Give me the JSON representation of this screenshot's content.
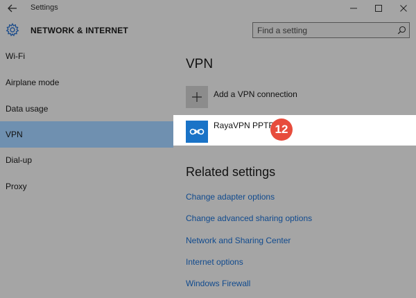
{
  "window": {
    "title": "Settings"
  },
  "header": {
    "section_title": "NETWORK & INTERNET",
    "search_placeholder": "Find a setting"
  },
  "sidebar": {
    "items": [
      {
        "label": "Wi-Fi",
        "active": false
      },
      {
        "label": "Airplane mode",
        "active": false
      },
      {
        "label": "Data usage",
        "active": false
      },
      {
        "label": "VPN",
        "active": true
      },
      {
        "label": "Dial-up",
        "active": false
      },
      {
        "label": "Proxy",
        "active": false
      }
    ]
  },
  "main": {
    "title": "VPN",
    "add_label": "Add a VPN connection",
    "connection": {
      "name": "RayaVPN PPTP",
      "badge": "12"
    },
    "related_title": "Related settings",
    "links": [
      "Change adapter options",
      "Change advanced sharing options",
      "Network and Sharing Center",
      "Internet options",
      "Windows Firewall"
    ]
  },
  "colors": {
    "background": "#a5a5a5",
    "active_nav": "#6f90b0",
    "link": "#104a8e",
    "badge": "#e74c3c",
    "vpn_logo": "#1a73c7"
  }
}
